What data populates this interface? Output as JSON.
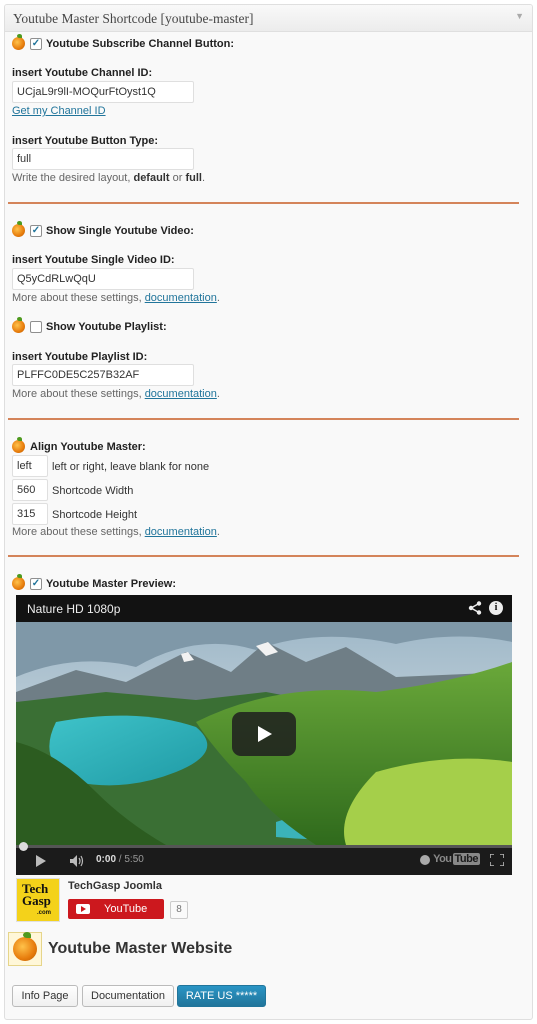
{
  "widget": {
    "title": "Youtube Master Shortcode [youtube-master]"
  },
  "subscribe": {
    "title": "Youtube Subscribe Channel Button:",
    "checked": true,
    "channel_label": "insert Youtube Channel ID:",
    "channel_value": "UCjaL9r9lI-MOQurFtOyst1Q",
    "channel_link": "Get my Channel ID",
    "type_label": "insert Youtube Button Type:",
    "type_value": "full",
    "help_prefix": "Write the desired layout, ",
    "help_default": "default",
    "help_or": " or ",
    "help_full": "full",
    "help_suffix": "."
  },
  "single": {
    "title": "Show Single Youtube Video:",
    "checked": true,
    "id_label": "insert Youtube Single Video ID:",
    "id_value": "Q5yCdRLwQqU",
    "help_prefix": "More about these settings, ",
    "help_link": "documentation",
    "help_suffix": "."
  },
  "playlist": {
    "title": "Show Youtube Playlist:",
    "checked": false,
    "id_label": "insert Youtube Playlist ID:",
    "id_value": "PLFFC0DE5C257B32AF",
    "help_prefix": "More about these settings, ",
    "help_link": "documentation",
    "help_suffix": "."
  },
  "align": {
    "title": "Align Youtube Master:",
    "align_value": "left",
    "align_label": "left or right, leave blank for none",
    "width_value": "560",
    "width_label": "Shortcode Width",
    "height_value": "315",
    "height_label": "Shortcode Height",
    "help_prefix": "More about these settings, ",
    "help_link": "documentation",
    "help_suffix": "."
  },
  "preview": {
    "title": "Youtube Master Preview:",
    "checked": true,
    "video_title": "Nature HD 1080p",
    "time_current": "0:00",
    "time_sep": " / ",
    "time_duration": "5:50",
    "yt_you": "You",
    "yt_tube": "Tube",
    "progress": 0.0
  },
  "channel": {
    "avatar_line1": "Tech",
    "avatar_line2": "Gasp",
    "avatar_line3": ".com",
    "name": "TechGasp Joomla",
    "subscribe_label": "YouTube",
    "count": "8"
  },
  "footer": {
    "site_title": "Youtube Master Website",
    "btn_info": "Info Page",
    "btn_docs": "Documentation",
    "btn_rate": "RATE US *****"
  },
  "colors": {
    "accent": "#21759b",
    "separator": "#d4845a",
    "youtube_red": "#cc181e"
  },
  "icons": {
    "section": "orange-fruit-icon",
    "share": "share-icon",
    "info": "info-icon"
  }
}
